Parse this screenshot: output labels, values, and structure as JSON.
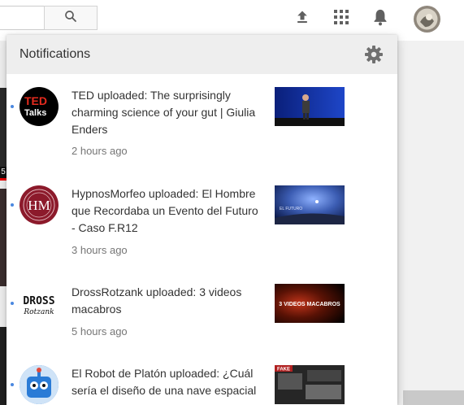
{
  "topbar": {
    "search": {
      "value": "",
      "placeholder": ""
    },
    "icons": [
      "search-icon",
      "upload-icon",
      "apps-grid-icon",
      "bell-icon"
    ],
    "avatar": "user-avatar"
  },
  "notifications": {
    "title": "Notifications",
    "settings_icon": "gear-icon",
    "accent": "#4a88e0",
    "items": [
      {
        "channel": "TED",
        "text": "TED uploaded: The surprisingly charming science of your gut | Giulia Enders",
        "time": "2 hours ago",
        "avatar_lines": [
          "TED",
          "Talks"
        ],
        "avatar_bg": "#000000",
        "thumb_colors": [
          "#0a1f7a",
          "#1e46c8"
        ]
      },
      {
        "channel": "HypnosMorfeo",
        "text": "HypnosMorfeo uploaded: El Hombre que Recordaba un Evento del Futuro - Caso F.R12",
        "time": "3 hours ago",
        "avatar_lines": [
          "HM"
        ],
        "avatar_bg": "#8c1a2b",
        "thumb_colors": [
          "#0e1d4f",
          "#4b6fc0"
        ],
        "thumb_caption": "EL FUTURO"
      },
      {
        "channel": "DrossRotzank",
        "text": "DrossRotzank uploaded: 3 videos macabros",
        "time": "5 hours ago",
        "avatar_lines": [
          "DROSS",
          "Rotzank"
        ],
        "avatar_bg": "#ffffff",
        "thumb_colors": [
          "#000000",
          "#c0341a"
        ],
        "thumb_caption": "3 VIDEOS MACABROS"
      },
      {
        "channel": "El Robot de Platón",
        "text": "El Robot de Platón uploaded: ¿Cuál sería el diseño de una nave espacial",
        "time": "",
        "avatar_bg": "#2a7bd6",
        "thumb_colors": [
          "#1b1b1b",
          "#5a5a5a"
        ],
        "thumb_caption": "FAKE"
      }
    ]
  }
}
